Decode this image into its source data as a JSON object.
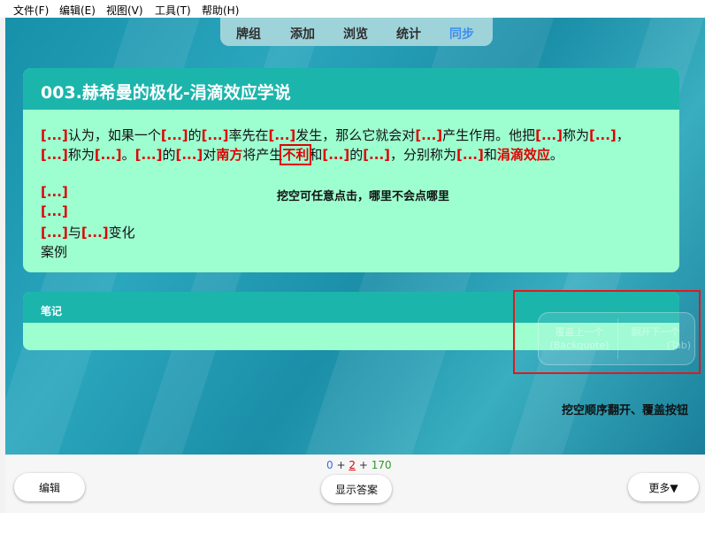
{
  "menu": {
    "items": [
      "文件(F)",
      "编辑(E)",
      "视图(V)",
      "工具(T)",
      "帮助(H)"
    ]
  },
  "nav": {
    "tabs": [
      "牌组",
      "添加",
      "浏览",
      "统计",
      "同步"
    ],
    "active": "同步"
  },
  "card": {
    "title": "003.赫希曼的极化-涓滴效应学说",
    "line1": {
      "s1": "[...]",
      "t1": "认为，如果一个",
      "s2": "[...]",
      "t2": "的",
      "s3": "[...]",
      "t3": "率先在",
      "s4": "[...]",
      "t4": "发生，那么它就会对",
      "s5": "[...]",
      "t5": "产生作用。他把",
      "s6": "[...]",
      "t6": "称为",
      "s7": "[...]",
      "t7": "，"
    },
    "line2": {
      "s1": "[...]",
      "t1": "称为",
      "s2": "[...]",
      "t2": "。",
      "s3": "[...]",
      "t3": "的",
      "s4": "[...]",
      "t4": "对",
      "r1": "南方",
      "t5": "将产生",
      "r2": "不利",
      "t6": "和",
      "s5": "[...]",
      "t7": "的",
      "s6": "[...]",
      "t8": "，分别称为",
      "s7": "[...]",
      "t9": "和",
      "r3": "涓滴效应",
      "t10": "。"
    },
    "line3": "[...]",
    "line4": "[...]",
    "line5": {
      "s1": "[...]",
      "t1": "与",
      "s2": "[...]",
      "t2": "变化"
    },
    "line6": "案例",
    "hint": "挖空可任意点击，哪里不会点哪里"
  },
  "notes": {
    "title": "笔记"
  },
  "overlay": {
    "prev_label": "覆盖上一个",
    "prev_key": "(Backquote)",
    "next_label": "翻开下一个",
    "next_key": "(Tab)",
    "hint": "挖空顺序翻开、覆盖按钮"
  },
  "bottom": {
    "counts": {
      "new": "0",
      "plus1": "+",
      "learn": "2",
      "plus2": "+",
      "review": "170"
    },
    "edit_label": "编辑",
    "show_answer_label": "显示答案",
    "more_label": "更多▼"
  },
  "colors": {
    "cloze": "#e00000",
    "card_bg": "#9dffd0",
    "card_head": "#1cb5ac",
    "nav_active": "#3c8df0",
    "count_new": "#3c6ee0",
    "count_learn": "#e00000",
    "count_review": "#2e9a2e"
  }
}
